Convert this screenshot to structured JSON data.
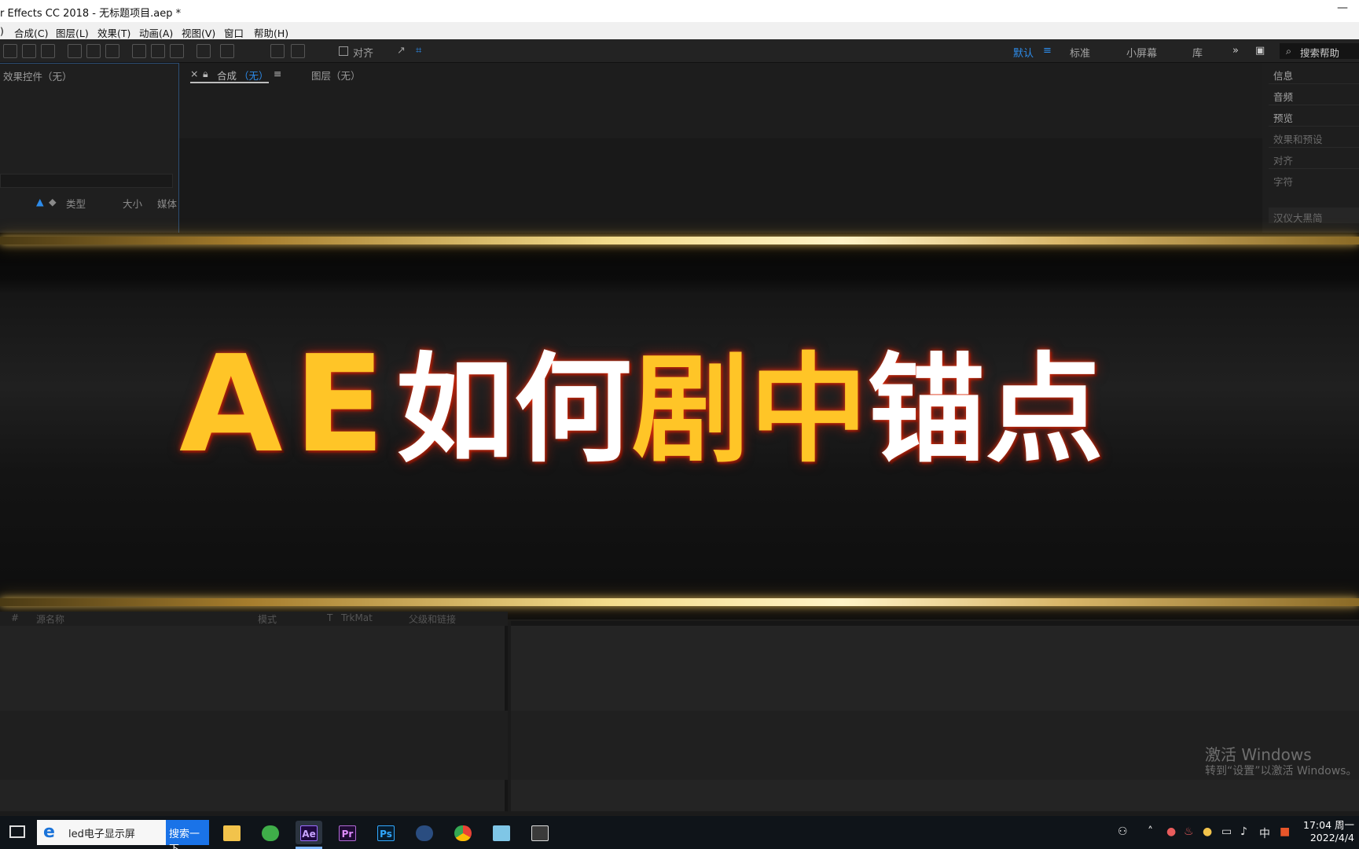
{
  "titlebar": {
    "title": "r Effects CC 2018 - 无标题项目.aep *",
    "min": "—"
  },
  "menu": [
    "合成(C)",
    "图层(L)",
    "效果(T)",
    "动画(A)",
    "视图(V)",
    "窗口",
    "帮助(H)"
  ],
  "menu_prefix": ")",
  "toolbar": {
    "align_label": "对齐",
    "workspaces": [
      "默认",
      "标准",
      "小屏幕",
      "库"
    ],
    "more": "»",
    "search_placeholder": "搜索帮助"
  },
  "left_panel": {
    "title": "效果控件（无）",
    "columns": [
      "类型",
      "大小",
      "媒体"
    ]
  },
  "comp_panel": {
    "close": "×",
    "comp_tab_label": "合成",
    "comp_tab_value": "（无）",
    "layer_tab": "图层（无）"
  },
  "right_panel": {
    "items": [
      "信息",
      "音频",
      "预览",
      "效果和预设",
      "对齐",
      "字符"
    ],
    "font_dropdown": "汉仪大黑简"
  },
  "banner": {
    "part1": "AE",
    "part2": "如何",
    "part3": "剧中",
    "part4": "锚点"
  },
  "timeline": {
    "columns": [
      "#",
      "源名称",
      "模式",
      "T",
      "TrkMat",
      "父级和链接"
    ]
  },
  "watermark": {
    "line1": "激活 Windows",
    "line2": "转到“设置”以激活 Windows。"
  },
  "taskbar": {
    "search_text": "led电子显示屏",
    "search_button": "搜索一下",
    "apps": [
      "Ae",
      "Pr",
      "Ps"
    ],
    "ime": "中",
    "time": "17:04 周一",
    "date": "2022/4/4"
  }
}
